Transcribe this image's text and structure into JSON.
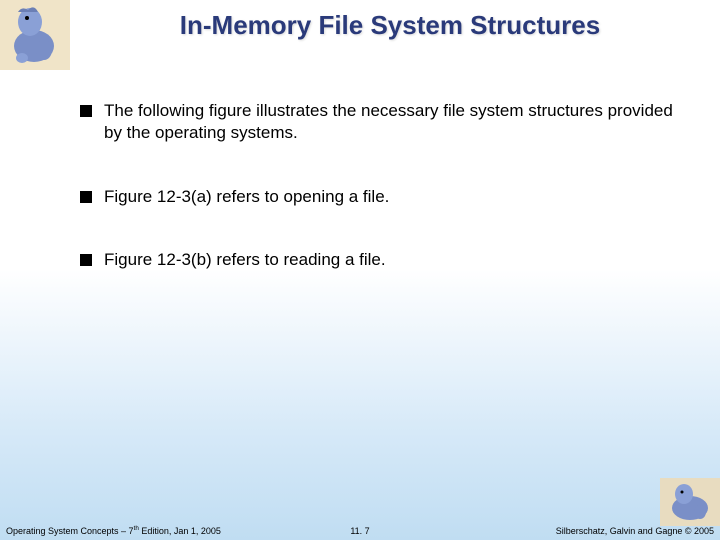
{
  "title": "In-Memory File System Structures",
  "bullets": [
    "The following figure illustrates the necessary file system structures provided by the operating systems.",
    "Figure 12-3(a) refers to opening a file.",
    "Figure 12-3(b) refers to reading a file."
  ],
  "footer": {
    "left_prefix": "Operating System Concepts – 7",
    "left_sup": "th",
    "left_suffix": " Edition, Jan 1, 2005",
    "center": "11. 7",
    "right": "Silberschatz, Galvin and Gagne © 2005"
  },
  "art": {
    "top_left": "dinosaur-mascot",
    "bottom_right": "dinosaur-mascot"
  }
}
